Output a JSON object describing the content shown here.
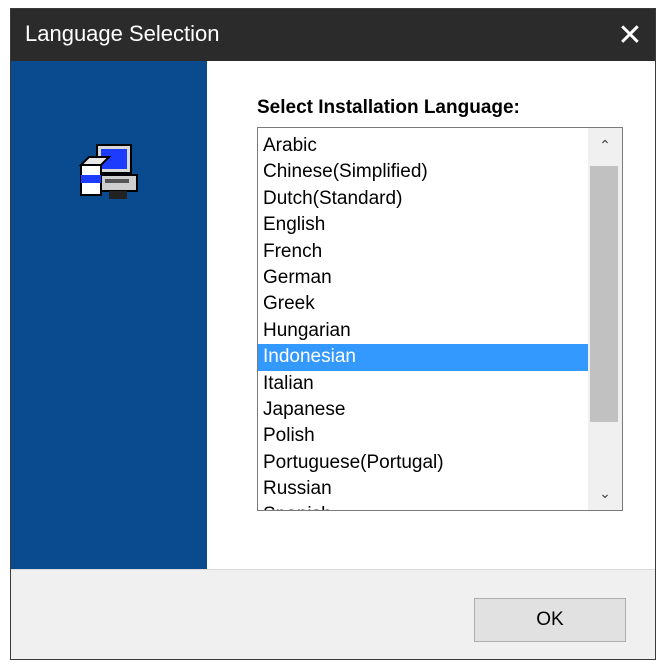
{
  "window": {
    "title": "Language Selection",
    "close_icon": "close-icon"
  },
  "side_panel": {
    "icon": "computer-install-icon",
    "color": "#0a4a8e"
  },
  "language_label": "Select Installation Language:",
  "languages": [
    "Arabic",
    "Chinese(Simplified)",
    "Dutch(Standard)",
    "English",
    "French",
    "German",
    "Greek",
    "Hungarian",
    "Indonesian",
    "Italian",
    "Japanese",
    "Polish",
    "Portuguese(Portugal)",
    "Russian",
    "Spanish"
  ],
  "selected_language": "Indonesian",
  "selected_color": "#3399ff",
  "ok_label": "OK"
}
